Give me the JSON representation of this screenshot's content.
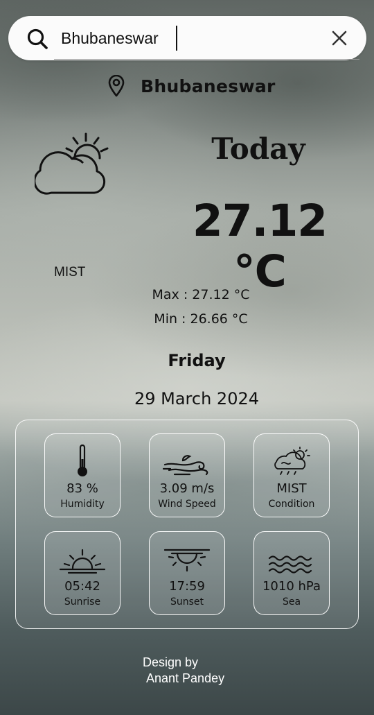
{
  "search": {
    "value": "Bhubaneswar",
    "icons": {
      "search": "search-icon",
      "clear": "close-icon"
    }
  },
  "location": {
    "icon": "map-pin-icon",
    "city": "Bhubaneswar"
  },
  "current": {
    "icon": "partly-cloudy-icon",
    "day_label": "Today",
    "temperature": "27.12 °C",
    "description": "MIST",
    "max": "Max : 27.12 °C",
    "min": "Min : 26.66 °C",
    "weekday": "Friday",
    "date": "29 March 2024"
  },
  "details": [
    {
      "icon": "thermometer-icon",
      "value": "83 %",
      "label": "Humidity"
    },
    {
      "icon": "wind-icon",
      "value": "3.09 m/s",
      "label": "Wind Speed"
    },
    {
      "icon": "cloud-sun-rain-icon",
      "value": "MIST",
      "label": "Condition"
    },
    {
      "icon": "sunrise-icon",
      "value": "05:42",
      "label": "Sunrise"
    },
    {
      "icon": "sunset-icon",
      "value": "17:59",
      "label": "Sunset"
    },
    {
      "icon": "waves-icon",
      "value": "1010 hPa",
      "label": "Sea"
    }
  ],
  "footer": {
    "line1": "Design by",
    "line2": "Anant Pandey"
  },
  "colors": {
    "text": "#111111",
    "search_bg": "#fbfbfb",
    "card_border": "#ffffff",
    "footer_text": "#ffffff"
  }
}
